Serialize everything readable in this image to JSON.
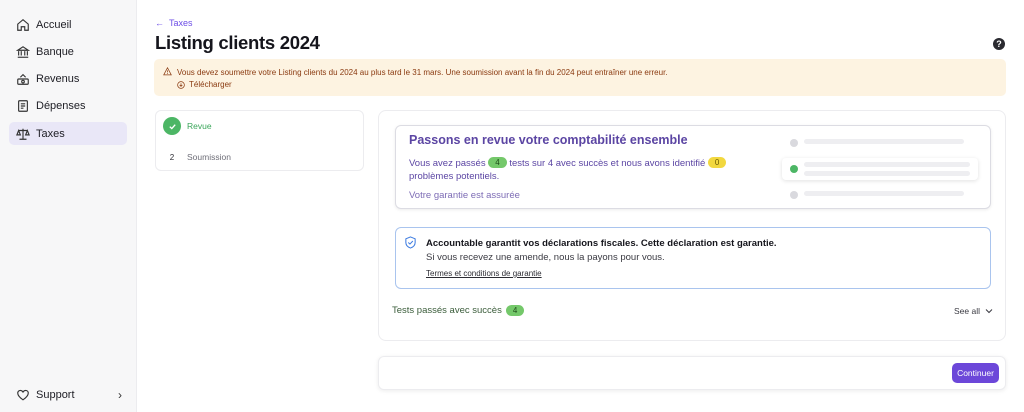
{
  "sidebar": {
    "items": [
      {
        "label": "Accueil",
        "icon": "home-icon"
      },
      {
        "label": "Banque",
        "icon": "bank-icon"
      },
      {
        "label": "Revenus",
        "icon": "revenue-icon"
      },
      {
        "label": "Dépenses",
        "icon": "receipt-icon"
      },
      {
        "label": "Taxes",
        "icon": "scale-icon",
        "active": true
      }
    ],
    "support": {
      "label": "Support",
      "icon": "heart-icon"
    }
  },
  "header": {
    "back_label": "Taxes",
    "title": "Listing clients 2024"
  },
  "alert": {
    "message": "Vous devez soumettre votre Listing clients du 2024 au plus tard le 31 mars. Une soumission avant la fin du 2024 peut entraîner une erreur.",
    "download_label": "Télécharger"
  },
  "steps": [
    {
      "label": "Revue",
      "status": "done"
    },
    {
      "number": "2",
      "label": "Soumission",
      "status": "pending"
    }
  ],
  "review": {
    "title": "Passons en revue votre comptabilité ensemble",
    "text_before": "Vous avez passés",
    "passed_count": "4",
    "text_middle": "tests sur 4 avec succès et nous avons identifié",
    "issues_count": "0",
    "text_after": "problèmes potentiels.",
    "guarantee_status": "Votre garantie est assurée"
  },
  "guarantee": {
    "title": "Accountable garantit vos déclarations fiscales. Cette déclaration est garantie.",
    "subtitle": "Si vous recevez une amende, nous la payons pour vous.",
    "link": "Termes et conditions de garantie"
  },
  "tests": {
    "label": "Tests passés avec succès",
    "count": "4",
    "see_all": "See all"
  },
  "footer": {
    "continue_label": "Continuer"
  },
  "colors": {
    "accent": "#6c47d9",
    "success": "#4cb665",
    "warning_bg": "#fdf3e1",
    "warning_text": "#8a3a10"
  }
}
